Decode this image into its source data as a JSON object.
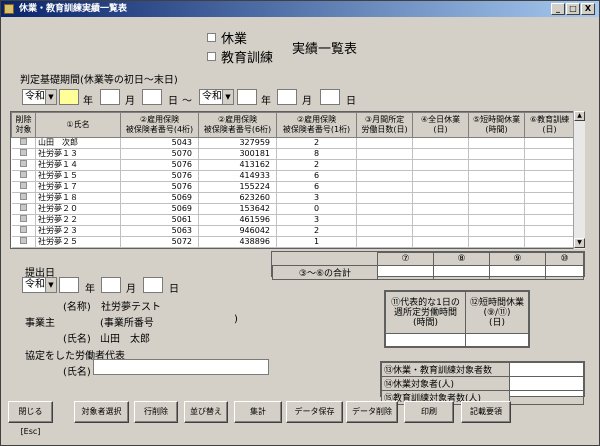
{
  "window": {
    "title": "休業・教育訓練実績一覧表",
    "min": "_",
    "max": "□",
    "close": "X"
  },
  "heading": {
    "opt1": "休業",
    "opt2": "教育訓練",
    "title": "実績一覧表"
  },
  "period": {
    "label": "判定基礎期間(休業等の初日～末日)",
    "era": "令和",
    "year_unit": "年",
    "month_unit": "月",
    "day_unit": "日",
    "tilde": "～",
    "arrow": "▼"
  },
  "grid": {
    "headers": [
      "削除\n対象",
      "①氏名",
      "②雇用保険\n被保険者番号(4桁)",
      "②雇用保険\n被保険者番号(6桁)",
      "②雇用保険\n被保険者番号(1桁)",
      "③月間所定\n労働日数(日)",
      "④全日休業\n(日)",
      "⑤短時間休業\n(時間)",
      "⑥教育訓練\n(日)"
    ],
    "rows": [
      {
        "name": "山田　次郎",
        "n4": "5043",
        "n6": "327959",
        "n1": "2"
      },
      {
        "name": "社労夢１３",
        "n4": "5070",
        "n6": "300181",
        "n1": "8"
      },
      {
        "name": "社労夢１４",
        "n4": "5076",
        "n6": "413162",
        "n1": "2"
      },
      {
        "name": "社労夢１５",
        "n4": "5076",
        "n6": "414933",
        "n1": "6"
      },
      {
        "name": "社労夢１７",
        "n4": "5076",
        "n6": "155224",
        "n1": "6"
      },
      {
        "name": "社労夢１８",
        "n4": "5069",
        "n6": "623260",
        "n1": "3"
      },
      {
        "name": "社労夢２０",
        "n4": "5069",
        "n6": "153642",
        "n1": "0"
      },
      {
        "name": "社労夢２２",
        "n4": "5061",
        "n6": "461596",
        "n1": "3"
      },
      {
        "name": "社労夢２３",
        "n4": "5063",
        "n6": "946042",
        "n1": "2"
      },
      {
        "name": "社労夢２５",
        "n4": "5072",
        "n6": "438896",
        "n1": "1"
      }
    ]
  },
  "totals": {
    "h7": "⑦",
    "h8": "⑧",
    "h9": "⑨",
    "h10": "⑩",
    "label": "③～⑥の合計"
  },
  "submit": {
    "label": "提出日",
    "era": "令和",
    "name_label": "(名称)",
    "name_value": "社労夢テスト",
    "employer": "事業主",
    "office_no_label": "(事業所番号",
    "office_no_close": ")",
    "person_label": "(氏名)",
    "person_value": "山田　太郎",
    "rep_label": "協定をした労働者代表",
    "rep_name_label": "(氏名)"
  },
  "box11": {
    "h1": "⑪代表的な1日の\n週所定労働時間\n(時間)",
    "h2": "⑫短時間休業\n(⑨/⑪)\n(日)"
  },
  "counts": [
    {
      "label": "⑬休業・教育訓練対象者数"
    },
    {
      "label": "⑭休業対象者(人)"
    },
    {
      "label": "⑮教育訓練対象者数(人)"
    }
  ],
  "buttons": [
    "閉じる[Esc]",
    "対象者選択",
    "行削除",
    "並び替え",
    "集計",
    "データ保存",
    "データ削除",
    "印刷",
    "記載要領"
  ]
}
